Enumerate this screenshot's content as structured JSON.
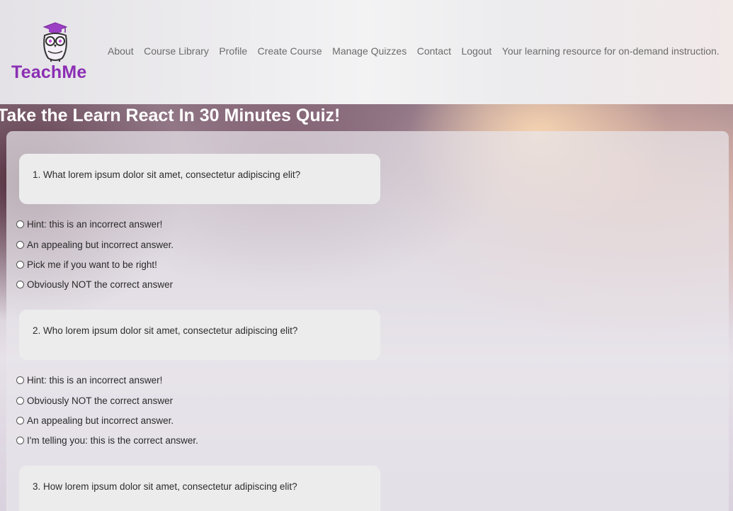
{
  "brand": {
    "name": "TeachMe",
    "color": "#8b2fb4"
  },
  "nav": {
    "items": [
      "About",
      "Course Library",
      "Profile",
      "Create Course",
      "Manage Quizzes",
      "Contact",
      "Logout"
    ],
    "tagline": "Your learning resource for on-demand instruction."
  },
  "quiz": {
    "title": "Take the Learn React In 30 Minutes Quiz!",
    "questions": [
      {
        "text": "1. What lorem ipsum dolor sit amet, consectetur adipiscing elit?",
        "options": [
          "Hint: this is an incorrect answer!",
          "An appealing but incorrect answer.",
          "Pick me if you want to be right!",
          "Obviously NOT the correct answer"
        ]
      },
      {
        "text": "2. Who lorem ipsum dolor sit amet, consectetur adipiscing elit?",
        "options": [
          "Hint: this is an incorrect answer!",
          "Obviously NOT the correct answer",
          "An appealing but incorrect answer.",
          "I'm telling you: this is the correct answer."
        ]
      },
      {
        "text": "3. How lorem ipsum dolor sit amet, consectetur adipiscing elit?",
        "options": []
      }
    ]
  }
}
